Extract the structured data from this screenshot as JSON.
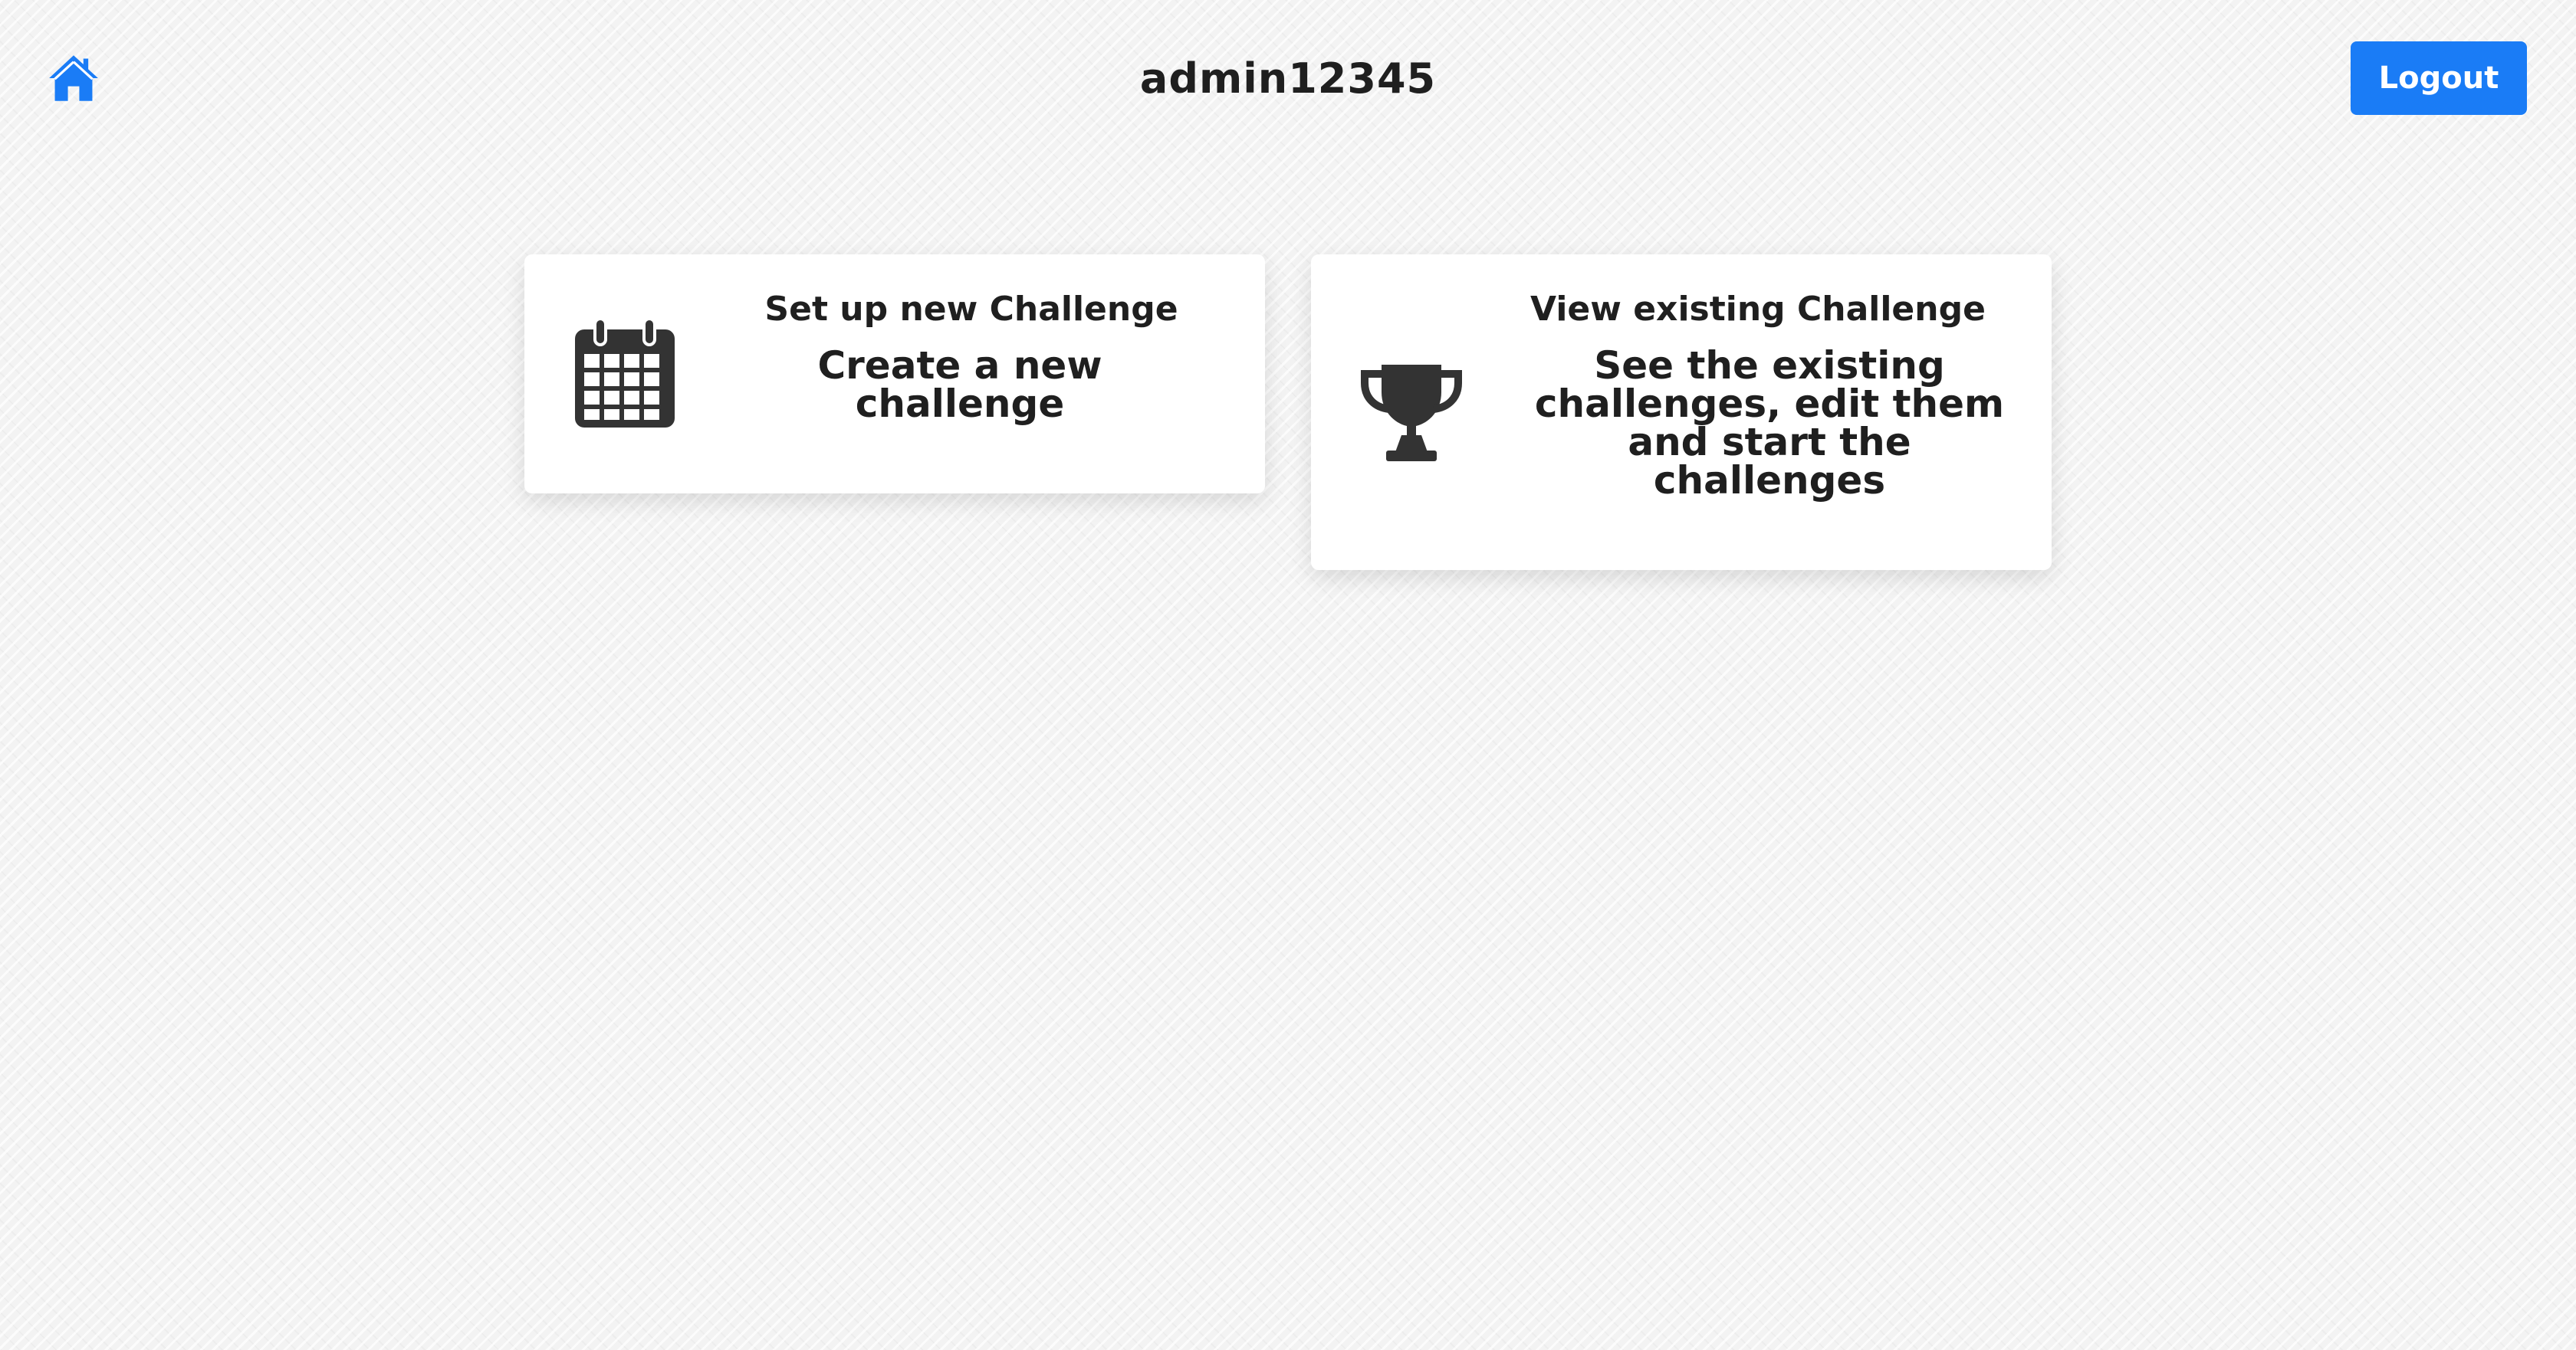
{
  "header": {
    "home_icon": "home-icon",
    "username": "admin12345",
    "logout_label": "Logout"
  },
  "cards": [
    {
      "icon": "calendar-icon",
      "title": "Set up new Challenge",
      "description": "Create a new challenge"
    },
    {
      "icon": "trophy-icon",
      "title": "View existing Challenge",
      "description": "See the existing challenges, edit them and start the challenges"
    }
  ],
  "colors": {
    "accent": "#1a7cf6",
    "text": "#1f1f1f",
    "icon": "#333333"
  }
}
